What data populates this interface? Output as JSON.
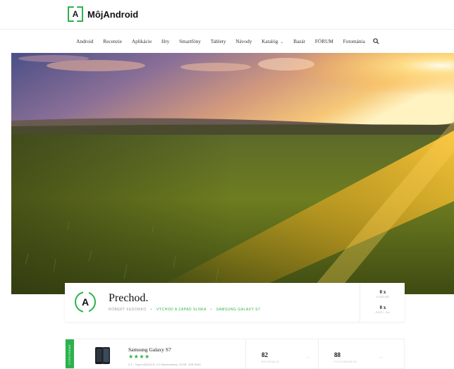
{
  "brand": {
    "logo_letter": "A",
    "name": "MôjAndroid"
  },
  "nav": {
    "items": [
      "Android",
      "Recenzie",
      "Aplikácie",
      "Hry",
      "Smartfóny",
      "Tablety",
      "Návody",
      "Katalóg",
      "Bazár",
      "FÓRUM",
      "Fotománia"
    ],
    "catalog_caret": "⌄"
  },
  "article": {
    "badge_letter": "A",
    "title": "Prechod.",
    "author": "RÓBERT FEDORKO",
    "separator": "•",
    "category": "VÝCHOD A ZÁPAD SLNKA",
    "device": "SAMSUNG GALAXY S7",
    "stats": [
      {
        "value": "0 x",
        "label": "VIDENÉ"
      },
      {
        "value": "0 x",
        "label": "PÁČI SA"
      }
    ]
  },
  "product": {
    "tag": "VYPOTREBÉ",
    "name": "Samsung Galaxy S7",
    "stars": "★★★★",
    "description": "5,1\", Super AMOLED, 4.0 Marshmallow, 32GB, 4GB RAM",
    "reviews": {
      "value": "82",
      "label": "RECENZIE"
    },
    "photos": {
      "value": "88",
      "label": "FOTOGRAFIE"
    },
    "arrow": "→"
  },
  "colors": {
    "accent": "#2bb24c"
  }
}
